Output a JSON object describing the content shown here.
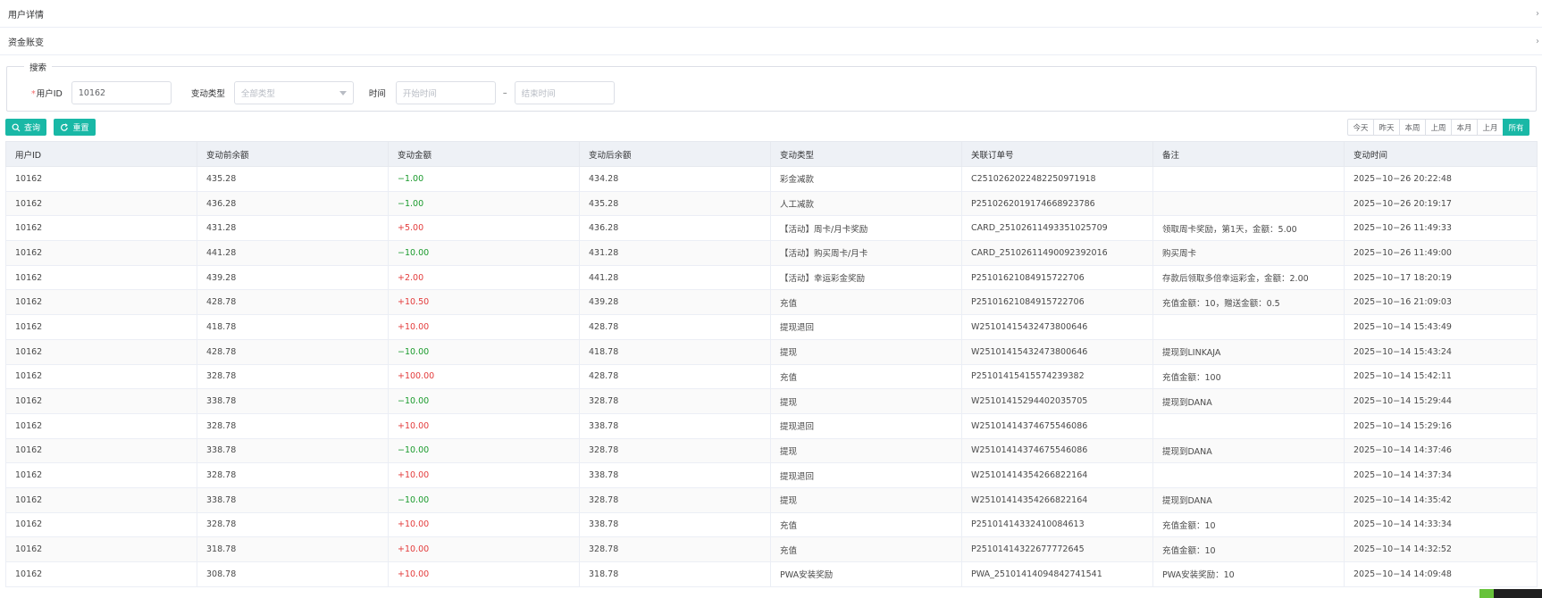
{
  "collapse": [
    {
      "title": "用户详情"
    },
    {
      "title": "资金账变"
    }
  ],
  "search": {
    "legend": "搜索",
    "user_id_label": "用户ID",
    "user_id_value": "10162",
    "type_label": "变动类型",
    "type_value": "全部类型",
    "time_label": "时间",
    "start_placeholder": "开始时间",
    "separator": "–",
    "end_placeholder": "结束时间"
  },
  "buttons": {
    "query": "查询",
    "reset": "重置"
  },
  "ranges": [
    "今天",
    "昨天",
    "本周",
    "上周",
    "本月",
    "上月",
    "所有"
  ],
  "table": {
    "columns": [
      "用户ID",
      "变动前余额",
      "变动金额",
      "变动后余额",
      "变动类型",
      "关联订单号",
      "备注",
      "变动时间"
    ],
    "rows": [
      [
        "10162",
        "435.28",
        "−1.00",
        "434.28",
        "彩金减款",
        "C2510262022482250971918",
        "",
        "2025−10−26 20:22:48"
      ],
      [
        "10162",
        "436.28",
        "−1.00",
        "435.28",
        "人工减款",
        "P251026201917466892378​6",
        "",
        "2025−10−26 20:19:17"
      ],
      [
        "10162",
        "431.28",
        "+5.00",
        "436.28",
        "【活动】周卡/月卡奖励",
        "CARD_25102611493351025709",
        "领取周卡奖励，第1天，金额：5.00",
        "2025−10−26 11:49:33"
      ],
      [
        "10162",
        "441.28",
        "−10.00",
        "431.28",
        "【活动】购买周卡/月卡",
        "CARD_25102611490092392016",
        "购买周卡",
        "2025−10−26 11:49:00"
      ],
      [
        "10162",
        "439.28",
        "+2.00",
        "441.28",
        "【活动】幸运彩金奖励",
        "P2510162108491572270​6",
        "存款后领取多倍幸运彩金，金额：2.00",
        "2025−10−17 18:20:19"
      ],
      [
        "10162",
        "428.78",
        "+10.50",
        "439.28",
        "充值",
        "P2510162108491572270​6",
        "充值金额：10，赠送金额：0.5",
        "2025−10−16 21:09:03"
      ],
      [
        "10162",
        "418.78",
        "+10.00",
        "428.78",
        "提现退回",
        "W2510141543247380064​6",
        "",
        "2025−10−14 15:43:49"
      ],
      [
        "10162",
        "428.78",
        "−10.00",
        "418.78",
        "提现",
        "W2510141543247380064​6",
        "提现到LINKAJA",
        "2025−10−14 15:43:24"
      ],
      [
        "10162",
        "328.78",
        "+100.00",
        "428.78",
        "充值",
        "P25101415415574239382",
        "充值金额：100",
        "2025−10−14 15:42:11"
      ],
      [
        "10162",
        "338.78",
        "−10.00",
        "328.78",
        "提现",
        "W25101415294402035705",
        "提现到DANA",
        "2025−10−14 15:29:44"
      ],
      [
        "10162",
        "328.78",
        "+10.00",
        "338.78",
        "提现退回",
        "W25101414374675546086",
        "",
        "2025−10−14 15:29:16"
      ],
      [
        "10162",
        "338.78",
        "−10.00",
        "328.78",
        "提现",
        "W25101414374675546086",
        "提现到DANA",
        "2025−10−14 14:37:46"
      ],
      [
        "10162",
        "328.78",
        "+10.00",
        "338.78",
        "提现退回",
        "W25101414354266822164",
        "",
        "2025−10−14 14:37:34"
      ],
      [
        "10162",
        "338.78",
        "−10.00",
        "328.78",
        "提现",
        "W25101414354266822164",
        "提现到DANA",
        "2025−10−14 14:35:42"
      ],
      [
        "10162",
        "328.78",
        "+10.00",
        "338.78",
        "充值",
        "P25101414332410084613",
        "充值金额：10",
        "2025−10−14 14:33:34"
      ],
      [
        "10162",
        "318.78",
        "+10.00",
        "328.78",
        "充值",
        "P25101414322677772645",
        "充值金额：10",
        "2025−10−14 14:32:52"
      ],
      [
        "10162",
        "308.78",
        "+10.00",
        "318.78",
        "PWA安装奖励",
        "PWA_25101414094842741541",
        "PWA安装奖励：10",
        "2025−10−14 14:09:48"
      ]
    ]
  },
  "colors": {
    "accent": "#19b8a6",
    "negative": "#1a9a2c",
    "positive": "#e33b3b"
  }
}
